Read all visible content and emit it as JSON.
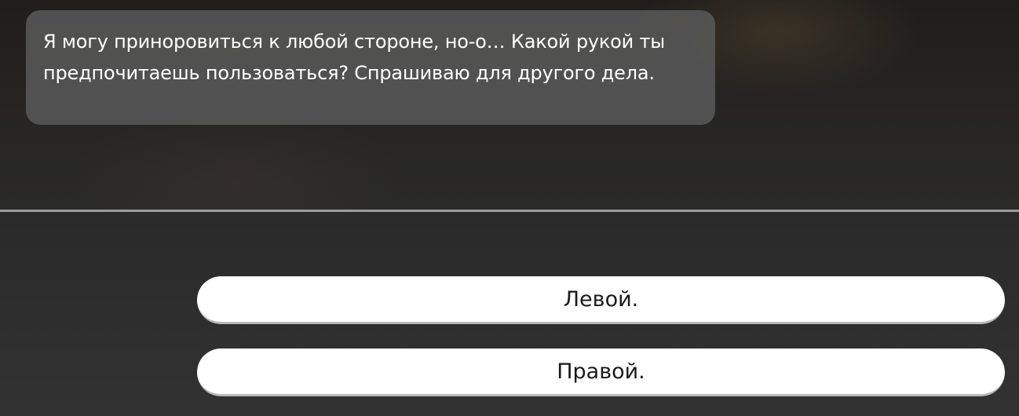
{
  "dialogue": {
    "text": "Я могу приноровиться к любой стороне, но-о… Какой рукой ты предпочитаешь пользоваться? Спрашиваю для другого дела."
  },
  "choices": [
    {
      "label": "Левой."
    },
    {
      "label": "Правой."
    }
  ],
  "colors": {
    "bubble": "#585858",
    "choice_button": "#ffffff",
    "choice_text": "#1a1a1a",
    "divider": "#9c9c9c"
  }
}
